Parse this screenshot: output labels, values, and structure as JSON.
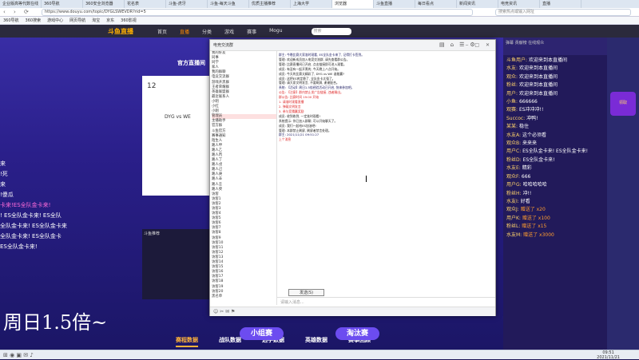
{
  "browser": {
    "tabs": [
      "企业版高等代数在线",
      "360导航",
      "360安全浏览器",
      "花名表",
      "斗鱼-虎牙",
      "斗鱼-每天斗鱼",
      "优质主播推荐",
      "上海大学",
      "浏览器",
      "斗鱼直播",
      "每日看点",
      "新闻资讯",
      "电竞资讯",
      "直播"
    ],
    "active_tab": 8,
    "url": "https://www.douyu.com/topic/DYGLSWEVDR?rid=5",
    "search_placeholder": "搜索热点或输入网址",
    "bookmarks": [
      "360导航",
      "360搜索",
      "游戏中心",
      "网页导航",
      "淘宝",
      "京东",
      "360影视"
    ]
  },
  "site": {
    "logo": "斗鱼直播",
    "nav": [
      "首页",
      "直播",
      "分类",
      "游戏",
      "赛事",
      "Mogu"
    ],
    "nav_active": 1,
    "search_placeholder": "搜索",
    "banner": "官方直播间",
    "player_num": "12",
    "player_vs": "DYG vs WE",
    "promo_lines": [
      "来",
      "!死",
      "来",
      "!傻瓜",
      "卡来!ES全队金卡来!",
      "! ES全队金卡来! ES全队",
      "全队金卡来! ES全队金卡来",
      "全队金卡来! ES全队金卡",
      "ES全队金卡来!"
    ],
    "lower_label": "斗鱼推荐"
  },
  "chat_window": {
    "title": "电竞交流群",
    "tree": [
      "我的好友",
      "  同事",
      "  同学",
      "  家人",
      "我的群聊",
      "  电竞交流群",
      "  游戏开黑群",
      "  王者荣耀群",
      "  英雄联盟群",
      "最近联系人",
      "  小明",
      "  小红",
      "  小刚",
      "  管理员",
      "  主播助手",
      "官方群",
      "  斗鱼官方",
      "  赛事通知",
      "陌生人",
      "  路人甲",
      "  路人乙",
      "  路人丙",
      "  路人丁",
      "  路人戊",
      "  路人己",
      "  路人庚",
      "  路人辛",
      "  路人壬",
      "  路人癸",
      "  访客",
      "  访客1",
      "  访客2",
      "  访客3",
      "  访客4",
      "  访客5",
      "  访客6",
      "  访客7",
      "  访客8",
      "  访客9",
      "  访客10",
      "  访客11",
      "  访客12",
      "  访客13",
      "  访客14",
      "  访客15",
      "  访客16",
      "  访客17",
      "  访客18",
      "  访客19",
      "  访客20",
      "  黑名单"
    ],
    "tree_selected": 13,
    "messages": [
      {
        "text": "群主: 今晚比赛大家准时观看, ES全队金卡来了, 记得打卡签到。",
        "c": "blue"
      },
      {
        "text": "管理: 欢迎新成员加入电竞交流群, 请先查看群公告。",
        "c": ""
      },
      {
        "text": "管理: 比赛直播间已开启, 点击链接即可进入观看。",
        "c": ""
      },
      {
        "text": "成员: 有没有一起开黑的, 今天晚上八点开始。",
        "c": ""
      },
      {
        "text": "成员: 今天的比赛太精彩了, DYG vs WE 谁能赢?",
        "c": ""
      },
      {
        "text": "成员: 这把ES肯定稳了, 全队金卡太强了。",
        "c": ""
      },
      {
        "text": "管理: 请大家文明发言, 不要刷屏, 谢谢配合。",
        "c": ""
      },
      {
        "text": "系统: 【活动】周日1.5倍经验活动已开启, 快来参加吧。",
        "c": "blue"
      },
      {
        "text": "公告: 【注意】群内禁止发广告链接, 违者踢出。",
        "c": "red"
      },
      {
        "text": "群公告: 比赛时间 19:00 开始",
        "c": "red"
      },
      {
        "text": "1. 请准时观看直播",
        "c": "red"
      },
      {
        "text": "2. 弹幕文明发言",
        "c": "red"
      },
      {
        "text": "3. 参与竞猜赢奖励",
        "c": "red"
      },
      {
        "text": "成员: 收到收到, 一定准时观看!",
        "c": ""
      },
      {
        "text": "系统提示: 你已加入群聊, 可以开始聊天了。",
        "c": ""
      },
      {
        "text": "成员: 我们一起给ES加油吧!",
        "c": ""
      },
      {
        "text": "管理: 本群禁止刷屏, 刷屏者禁言处理。",
        "c": ""
      },
      {
        "text": "群主: 2021/11/21 09:51:27",
        "c": "blue"
      },
      {
        "text": "上个消息",
        "c": "red"
      }
    ],
    "send_button": "发送(S)",
    "input_placeholder": "请输入消息..."
  },
  "right_chat": {
    "header": "弹幕 贡献榜 在线观众",
    "lines": [
      {
        "n": "斗鱼用户:",
        "t": "欢迎来到本直播间"
      },
      {
        "n": "水友:",
        "t": "欢迎来到本直播间"
      },
      {
        "n": "观众:",
        "t": "欢迎来到本直播间"
      },
      {
        "n": "粉丝:",
        "t": "欢迎来到本直播间"
      },
      {
        "n": "用户:",
        "t": "欢迎来到本直播间"
      },
      {
        "n": "小鱼:",
        "t": "666666"
      },
      {
        "n": "观赛:",
        "t": "ES冲冲冲!!"
      },
      {
        "n": "Succoc:",
        "t": "冲鸭!"
      },
      {
        "n": "某某:",
        "t": "稳住"
      },
      {
        "n": "水友A:",
        "t": "这个必须看"
      },
      {
        "n": "观众B:",
        "t": "来来来"
      },
      {
        "n": "用户C:",
        "t": "ES全队金卡来! ES全队金卡来!"
      },
      {
        "n": "粉丝D:",
        "t": "ES全队金卡来!"
      },
      {
        "n": "水友E:",
        "t": "精彩"
      },
      {
        "n": "观众F:",
        "t": "666"
      },
      {
        "n": "用户G:",
        "t": "哈哈哈哈哈"
      },
      {
        "n": "粉丝H:",
        "t": "冲!!"
      },
      {
        "n": "水友I:",
        "t": "好看"
      },
      {
        "n": "观众J:",
        "t": "赠送了 x20",
        "g": true
      },
      {
        "n": "用户K:",
        "t": "赠送了 x100",
        "g": true
      },
      {
        "n": "粉丝L:",
        "t": "赠送了 x15",
        "g": true
      },
      {
        "n": "水友M:",
        "t": "赠送了 x3000",
        "g": true
      }
    ]
  },
  "side_badge": "领取",
  "schedule_tabs": [
    "赛程数据",
    "战队数据",
    "选手数据",
    "英雄数据",
    "赛事回顾"
  ],
  "pills": [
    "小组赛",
    "淘汰赛"
  ],
  "subtitle": "周日1.5倍~",
  "taskbar": {
    "time": "09:51",
    "date": "2021/11/21"
  }
}
